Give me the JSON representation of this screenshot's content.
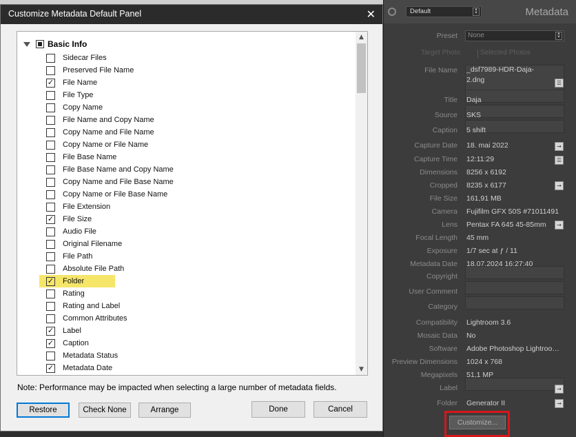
{
  "dialog": {
    "title": "Customize Metadata Default Panel",
    "close_glyph": "✕",
    "group_label": "Basic Info",
    "items": [
      {
        "label": "Sidecar Files",
        "checked": false
      },
      {
        "label": "Preserved File Name",
        "checked": false
      },
      {
        "label": "File Name",
        "checked": true
      },
      {
        "label": "File Type",
        "checked": false
      },
      {
        "label": "Copy Name",
        "checked": false
      },
      {
        "label": "File Name and Copy Name",
        "checked": false
      },
      {
        "label": "Copy Name and File Name",
        "checked": false
      },
      {
        "label": "Copy Name or File Name",
        "checked": false
      },
      {
        "label": "File Base Name",
        "checked": false
      },
      {
        "label": "File Base Name and Copy Name",
        "checked": false
      },
      {
        "label": "Copy Name and File Base Name",
        "checked": false
      },
      {
        "label": "Copy Name or File Base Name",
        "checked": false
      },
      {
        "label": "File Extension",
        "checked": false
      },
      {
        "label": "File Size",
        "checked": true
      },
      {
        "label": "Audio File",
        "checked": false
      },
      {
        "label": "Original Filename",
        "checked": false
      },
      {
        "label": "File Path",
        "checked": false
      },
      {
        "label": "Absolute File Path",
        "checked": false
      },
      {
        "label": "Folder",
        "checked": true,
        "highlight": true
      },
      {
        "label": "Rating",
        "checked": false
      },
      {
        "label": "Rating and Label",
        "checked": false
      },
      {
        "label": "Common Attributes",
        "checked": false
      },
      {
        "label": "Label",
        "checked": true
      },
      {
        "label": "Caption",
        "checked": true
      },
      {
        "label": "Metadata Status",
        "checked": false
      },
      {
        "label": "Metadata Date",
        "checked": true
      }
    ],
    "note": "Note: Performance may be impacted when selecting a large number of metadata fields.",
    "buttons": {
      "restore": "Restore",
      "check_none": "Check None",
      "arrange": "Arrange",
      "done": "Done",
      "cancel": "Cancel"
    },
    "highlight_color": "#f5e66a"
  },
  "panel": {
    "preset_menu": "Default",
    "title": "Metadata",
    "preset_label": "Preset",
    "preset_value": "None",
    "tab_target": "Target Photo",
    "tab_selected": "Selected Photos",
    "fields": [
      {
        "label": "File Name",
        "value": "_dsf7989-HDR-Daja-2.dng"
      },
      {
        "label": "Title",
        "value": "Daja"
      },
      {
        "label": "Source",
        "value": "SKS"
      },
      {
        "label": "Caption",
        "value": "5 shift"
      },
      {
        "label": "Capture Date",
        "value": "18. mai 2022"
      },
      {
        "label": "Capture Time",
        "value": "12:11:29"
      },
      {
        "label": "Dimensions",
        "value": "8256 x 6192"
      },
      {
        "label": "Cropped",
        "value": "8235 x 6177"
      },
      {
        "label": "File Size",
        "value": "161,91 MB"
      },
      {
        "label": "Camera",
        "value": "Fujifilm GFX 50S #71011491"
      },
      {
        "label": "Lens",
        "value": "Pentax FA 645 45-85mm"
      },
      {
        "label": "Focal Length",
        "value": "45 mm"
      },
      {
        "label": "Exposure",
        "value": "1/7 sec at ƒ / 11"
      },
      {
        "label": "Metadata Date",
        "value": "18.07.2024 16:27:40"
      },
      {
        "label": "Copyright",
        "value": ""
      },
      {
        "label": "User Comment",
        "value": ""
      },
      {
        "label": "Category",
        "value": ""
      },
      {
        "label": "Compatibility",
        "value": "Lightroom 3.6"
      },
      {
        "label": "Mosaic Data",
        "value": "No"
      },
      {
        "label": "Software",
        "value": "Adobe Photoshop Lightroo…"
      },
      {
        "label": "Preview Dimensions",
        "value": "1024 x 768"
      },
      {
        "label": "Megapixels",
        "value": "51,1 MP"
      },
      {
        "label": "Label",
        "value": ""
      },
      {
        "label": "Folder",
        "value": "Generator II"
      }
    ],
    "customize_button": "Customize...",
    "highlight_outline_color": "#d5171b"
  }
}
